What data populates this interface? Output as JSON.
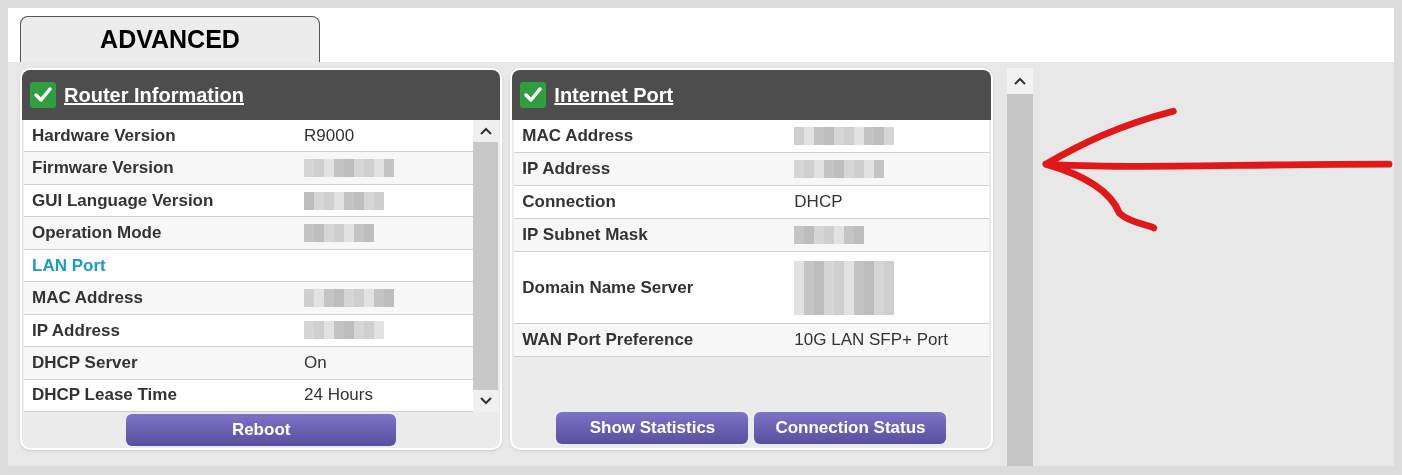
{
  "tab": {
    "label": "ADVANCED",
    "selected": true
  },
  "panels": [
    {
      "title": "Router Information",
      "verified": true,
      "scrollable": true,
      "rows": [
        {
          "kind": "text",
          "label": "Hardware Version",
          "value": "R9000"
        },
        {
          "kind": "redacted",
          "label": "Firmware Version"
        },
        {
          "kind": "redacted",
          "label": "GUI Language Version"
        },
        {
          "kind": "redacted",
          "label": "Operation Mode"
        },
        {
          "kind": "section",
          "label": "LAN Port"
        },
        {
          "kind": "redacted",
          "label": "MAC Address"
        },
        {
          "kind": "redacted",
          "label": "IP Address"
        },
        {
          "kind": "text",
          "label": "DHCP Server",
          "value": "On"
        },
        {
          "kind": "text",
          "label": "DHCP Lease Time",
          "value": "24 Hours"
        }
      ],
      "buttons": [
        "Reboot"
      ]
    },
    {
      "title": "Internet Port",
      "verified": true,
      "scrollable": false,
      "rows": [
        {
          "kind": "redacted",
          "label": "MAC Address"
        },
        {
          "kind": "redacted",
          "label": "IP Address"
        },
        {
          "kind": "text",
          "label": "Connection",
          "value": "DHCP"
        },
        {
          "kind": "redacted",
          "label": "IP Subnet Mask"
        },
        {
          "kind": "redacted_tall",
          "label": "Domain Name Server"
        },
        {
          "kind": "text",
          "label": "WAN Port Preference",
          "value": "10G LAN SFP+ Port"
        }
      ],
      "buttons": [
        "Show Statistics",
        "Connection Status"
      ]
    }
  ],
  "annotations": [
    {
      "kind": "arrow"
    }
  ]
}
